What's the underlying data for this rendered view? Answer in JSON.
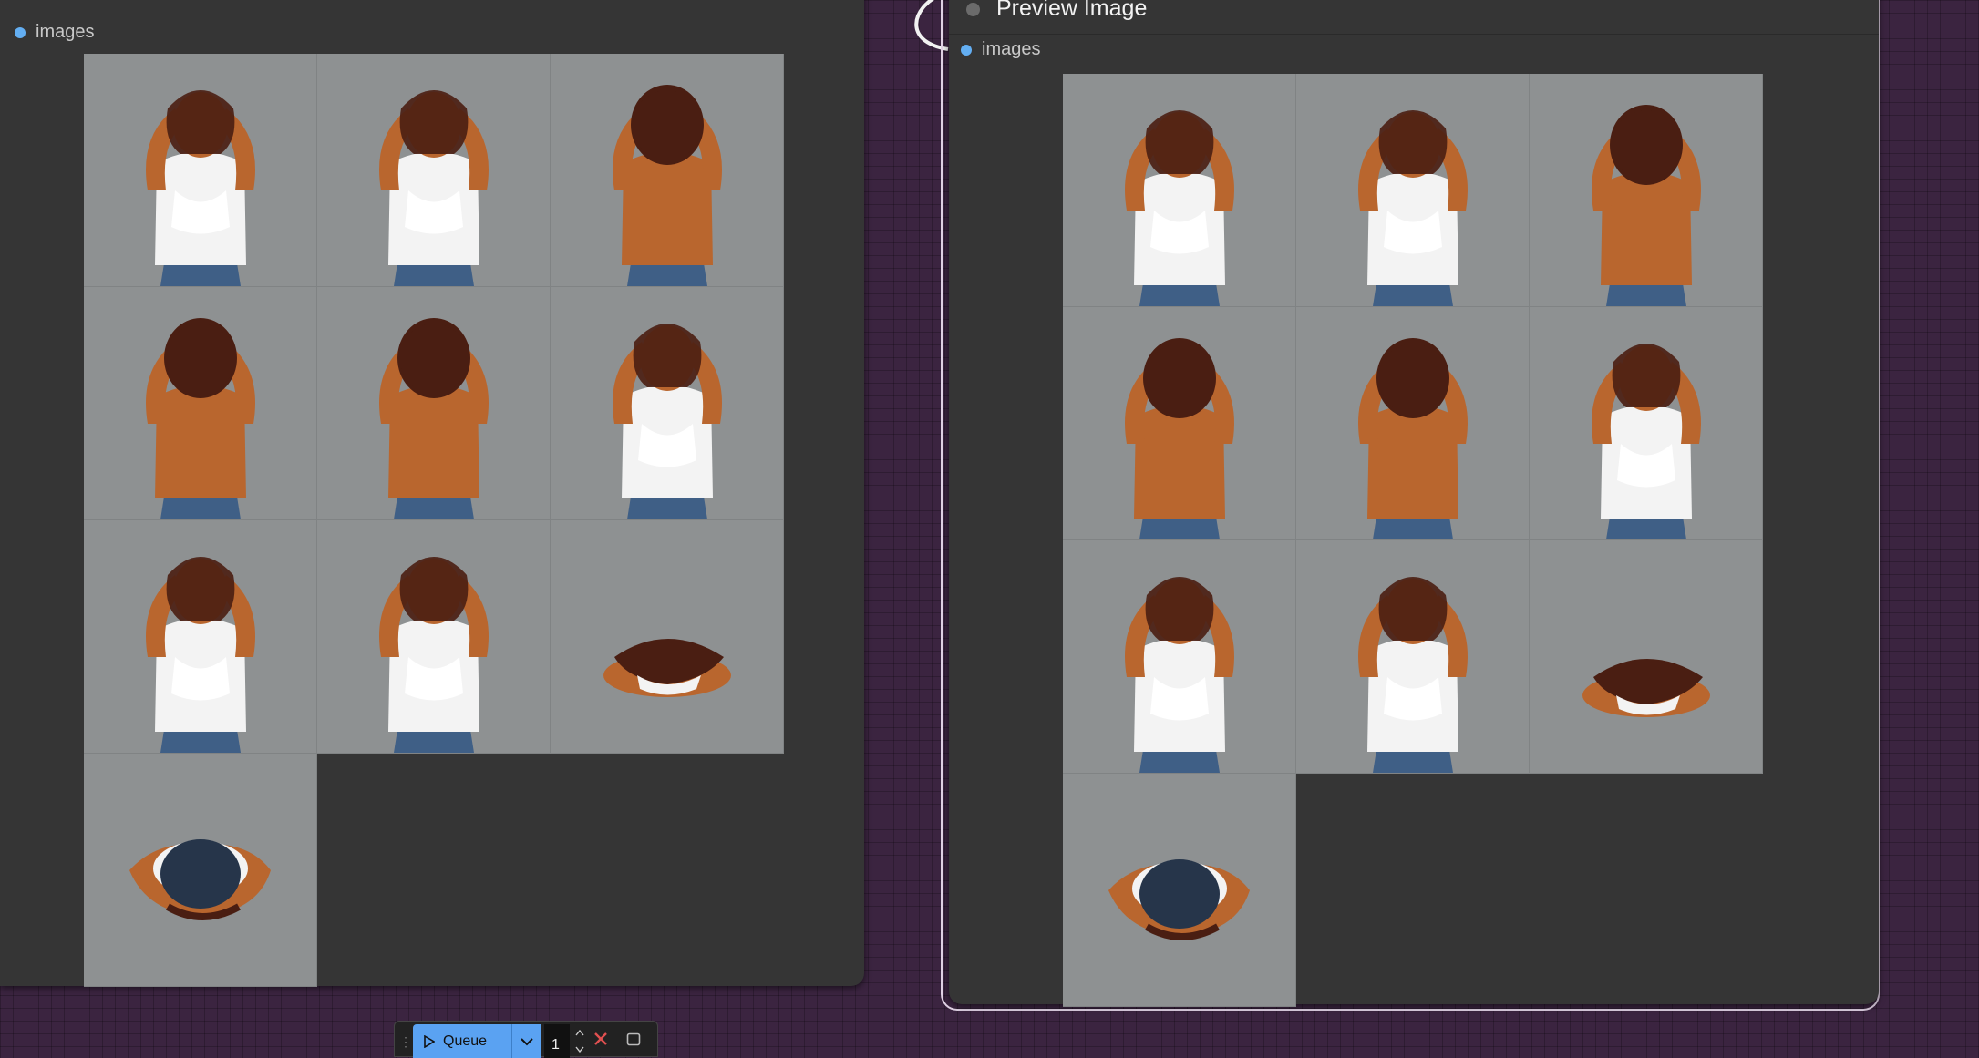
{
  "left_node": {
    "output_label": "images",
    "images": [
      {
        "view": "front-left"
      },
      {
        "view": "left-side"
      },
      {
        "view": "back-left"
      },
      {
        "view": "back"
      },
      {
        "view": "back-right"
      },
      {
        "view": "right-side"
      },
      {
        "view": "front-turned"
      },
      {
        "view": "front"
      },
      {
        "view": "top"
      },
      {
        "view": "bottom"
      }
    ]
  },
  "right_node": {
    "title": "Preview Image",
    "input_label": "images",
    "images": [
      {
        "view": "front-left"
      },
      {
        "view": "left-side"
      },
      {
        "view": "back-left"
      },
      {
        "view": "back"
      },
      {
        "view": "back-right"
      },
      {
        "view": "right-side"
      },
      {
        "view": "front-turned"
      },
      {
        "view": "front"
      },
      {
        "view": "top"
      },
      {
        "view": "bottom"
      }
    ]
  },
  "toolbar": {
    "queue_label": "Queue",
    "batch_count": "1",
    "icons": [
      "drag-handle-icon",
      "play-icon",
      "chevron-down-icon",
      "close-icon",
      "stop-icon"
    ]
  },
  "colors": {
    "canvas": "#3b2440",
    "node_body": "#353535",
    "slot_dot": "#63aef2",
    "queue_button": "#5aa2f2",
    "image_background": "#8e9192",
    "selection_outline": "#e2d3e6"
  }
}
